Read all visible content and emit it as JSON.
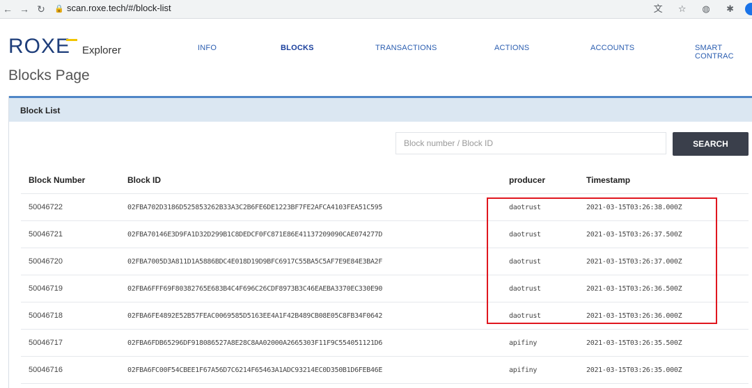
{
  "browser": {
    "url": "scan.roxe.tech/#/block-list"
  },
  "site": {
    "logo": "ROXE",
    "subtitle": "Explorer",
    "nav": [
      "INFO",
      "BLOCKS",
      "TRANSACTIONS",
      "ACTIONS",
      "ACCOUNTS",
      "SMART CONTRAC"
    ],
    "active_nav": "BLOCKS",
    "page_title": "Blocks Page"
  },
  "panel": {
    "title": "Block List",
    "search_placeholder": "Block number / Block ID",
    "search_label": "SEARCH"
  },
  "table": {
    "headers": [
      "Block Number",
      "Block ID",
      "producer",
      "Timestamp"
    ],
    "rows": [
      {
        "number": "50046722",
        "id": "02FBA702D3186D525853262B33A3C2B6FE6DE1223BF7FE2AFCA4103FEA51C595",
        "producer": "daotrust",
        "timestamp": "2021-03-15T03:26:38.000Z"
      },
      {
        "number": "50046721",
        "id": "02FBA70146E3D9FA1D32D299B1C8DEDCF0FC871E86E41137209090CAE074277D",
        "producer": "daotrust",
        "timestamp": "2021-03-15T03:26:37.500Z"
      },
      {
        "number": "50046720",
        "id": "02FBA7005D3A811D1A5886BDC4E018D19D9BFC6917C55BA5C5AF7E9E84E3BA2F",
        "producer": "daotrust",
        "timestamp": "2021-03-15T03:26:37.000Z"
      },
      {
        "number": "50046719",
        "id": "02FBA6FFF69F80382765E683B4C4F696C26CDF8973B3C46EAEBA3370EC330E90",
        "producer": "daotrust",
        "timestamp": "2021-03-15T03:26:36.500Z"
      },
      {
        "number": "50046718",
        "id": "02FBA6FE4892E52B57FEAC0069585D5163EE4A1F42B489CB08E05C8FB34F0642",
        "producer": "daotrust",
        "timestamp": "2021-03-15T03:26:36.000Z"
      },
      {
        "number": "50046717",
        "id": "02FBA6FDB65296DF918086527A8E28C8AA02000A2665303F11F9C554051121D6",
        "producer": "apifiny",
        "timestamp": "2021-03-15T03:26:35.500Z"
      },
      {
        "number": "50046716",
        "id": "02FBA6FC00F54CBEE1F67A56D7C6214F65463A1ADC93214EC0D350B1D6FEB46E",
        "producer": "apifiny",
        "timestamp": "2021-03-15T03:26:35.000Z"
      }
    ]
  },
  "annotation": {
    "color": "#e0161e"
  }
}
